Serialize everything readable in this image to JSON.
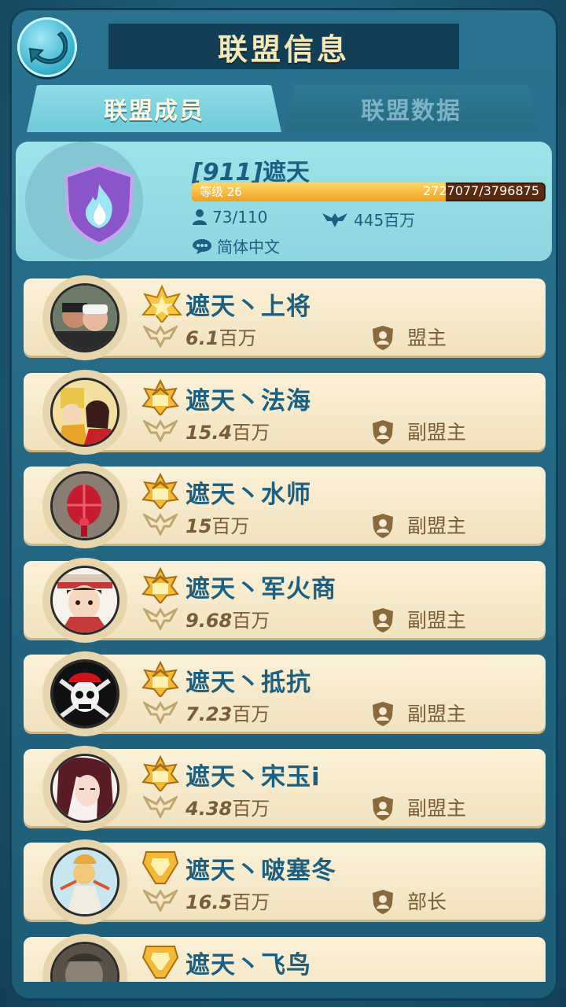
{
  "header": {
    "title": "联盟信息",
    "back_icon": "back-arrow-icon"
  },
  "tabs": [
    {
      "label": "联盟成员",
      "active": true
    },
    {
      "label": "联盟数据",
      "active": false
    }
  ],
  "alliance": {
    "tag": "[911]",
    "name": "遮天",
    "level_label": "等级 26",
    "exp_text": "2727077/3796875",
    "exp_fraction": 0.718,
    "members": "73/110",
    "power": "445百万",
    "language": "简体中文",
    "emblem_icon": "purple-flame-shield-icon"
  },
  "members": [
    {
      "name": "遮天丶上将",
      "power_num": "6.1",
      "power_unit": "百万",
      "role": "盟主",
      "rank": "leader",
      "avatar": "couple-photo"
    },
    {
      "name": "遮天丶法海",
      "power_num": "15.4",
      "power_unit": "百万",
      "role": "副盟主",
      "rank": "deputy",
      "avatar": "monk-portrait"
    },
    {
      "name": "遮天丶水师",
      "power_num": "15",
      "power_unit": "百万",
      "role": "副盟主",
      "rank": "deputy",
      "avatar": "red-lantern"
    },
    {
      "name": "遮天丶军火商",
      "power_num": "9.68",
      "power_unit": "百万",
      "role": "副盟主",
      "rank": "deputy",
      "avatar": "anime-boy"
    },
    {
      "name": "遮天丶抵抗",
      "power_num": "7.23",
      "power_unit": "百万",
      "role": "副盟主",
      "rank": "deputy",
      "avatar": "pirate-skull"
    },
    {
      "name": "遮天丶宋玉i",
      "power_num": "4.38",
      "power_unit": "百万",
      "role": "副盟主",
      "rank": "deputy",
      "avatar": "anime-girl"
    },
    {
      "name": "遮天丶啵塞冬",
      "power_num": "16.5",
      "power_unit": "百万",
      "role": "部长",
      "rank": "officer",
      "avatar": "fantasy-art"
    },
    {
      "name": "遮天丶飞鸟",
      "power_num": "",
      "power_unit": "",
      "role": "",
      "rank": "officer",
      "avatar": "grey-photo"
    }
  ],
  "colors": {
    "accent": "#1c5f80",
    "card": "#f7ead0",
    "panel": "#1d5c76",
    "gold": "#f0a020"
  }
}
